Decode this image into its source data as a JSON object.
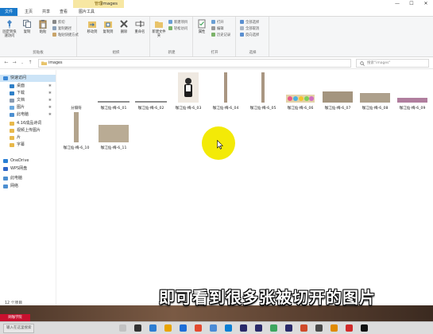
{
  "window": {
    "title": "images",
    "context_tab": "管理",
    "controls": [
      "—",
      "☐",
      "✕"
    ]
  },
  "ribbon_tabs": {
    "file": "文件",
    "home": "主页",
    "share": "共享",
    "view": "查看",
    "picture_tools": "图片工具"
  },
  "ribbon": {
    "clipboard": {
      "label": "剪贴板",
      "pin": "固定到快速访问",
      "copy": "复制",
      "paste": "粘贴",
      "cut": "剪切",
      "copy_path": "复制路径",
      "paste_shortcut": "粘贴快捷方式"
    },
    "organize": {
      "label": "组织",
      "move_to": "移动到",
      "copy_to": "复制到",
      "delete": "删除",
      "rename": "重命名"
    },
    "new": {
      "label": "新建",
      "new_folder": "新建文件夹",
      "new_item": "新建项目",
      "easy_access": "轻松访问"
    },
    "open": {
      "label": "打开",
      "properties": "属性",
      "open": "打开",
      "edit": "编辑",
      "history": "历史记录"
    },
    "select": {
      "label": "选择",
      "select_all": "全部选择",
      "select_none": "全部取消",
      "invert": "反向选择"
    }
  },
  "address": {
    "path": "images",
    "search_placeholder": "搜索\"images\""
  },
  "nav": {
    "items": [
      {
        "label": "快速访问",
        "color": "#3a87d6",
        "pinned": false,
        "indent": 0
      },
      {
        "label": "桌面",
        "color": "#2f80c8",
        "pinned": true,
        "indent": 1
      },
      {
        "label": "下载",
        "color": "#2f80c8",
        "pinned": true,
        "indent": 1
      },
      {
        "label": "文档",
        "color": "#8a9bb0",
        "pinned": true,
        "indent": 1
      },
      {
        "label": "图片",
        "color": "#6aa8de",
        "pinned": true,
        "indent": 1
      },
      {
        "label": "此电脑",
        "color": "#4c8fd1",
        "pinned": true,
        "indent": 1
      },
      {
        "label": "4.16成品诗词",
        "color": "#e8b84a",
        "pinned": false,
        "indent": 1
      },
      {
        "label": "视频上传图片",
        "color": "#e8b84a",
        "pinned": false,
        "indent": 1
      },
      {
        "label": "片",
        "color": "#e8b84a",
        "pinned": false,
        "indent": 1
      },
      {
        "label": "字幕",
        "color": "#e8b84a",
        "pinned": false,
        "indent": 1
      },
      {
        "label": "OneDrive",
        "color": "#2a7fd4",
        "pinned": false,
        "indent": 0
      },
      {
        "label": "WPS网盘",
        "color": "#2f66c9",
        "pinned": false,
        "indent": 0
      },
      {
        "label": "此电脑",
        "color": "#4c8fd1",
        "pinned": false,
        "indent": 0
      },
      {
        "label": "网络",
        "color": "#4c8fd1",
        "pinned": false,
        "indent": 0
      }
    ]
  },
  "files": [
    {
      "name": "分隔符",
      "kind": "blank"
    },
    {
      "name": "咖江仙-梅-6_01",
      "kind": "strip"
    },
    {
      "name": "咖江仙-梅-6_02",
      "kind": "strip"
    },
    {
      "name": "咖江仙-梅-6_03",
      "kind": "person"
    },
    {
      "name": "咖江仙-梅-6_04",
      "kind": "tall"
    },
    {
      "name": "咖江仙-梅-6_05",
      "kind": "tall"
    },
    {
      "name": "咖江仙-梅-6_06",
      "kind": "colorful"
    },
    {
      "name": "咖江仙-梅-6_07",
      "kind": "wide"
    },
    {
      "name": "咖江仙-梅-6_08",
      "kind": "wide2"
    },
    {
      "name": "咖江仙-梅-6_09",
      "kind": "pink"
    },
    {
      "name": "咖江仙-梅-6_10",
      "kind": "tall2"
    },
    {
      "name": "咖江仙-梅-6_11",
      "kind": "box"
    }
  ],
  "status": {
    "count": "12 个项目"
  },
  "subtitle": "即可看到很多张被切开的图片",
  "taskbar": {
    "search_hint": "输入在这里搜索",
    "watermark": "网咖学院",
    "icons": [
      "#c2c2c2",
      "#333333",
      "#2d7dd2",
      "#e8a400",
      "#1e6ed8",
      "#e34a2f",
      "#4a8bd6",
      "#0a7fd4",
      "#2a2a6a",
      "#2a2a6a",
      "#3ea65f",
      "#2a2a6a",
      "#d04a2a",
      "#4a4a4a",
      "#e08a00",
      "#d12b2b",
      "#111111"
    ]
  }
}
